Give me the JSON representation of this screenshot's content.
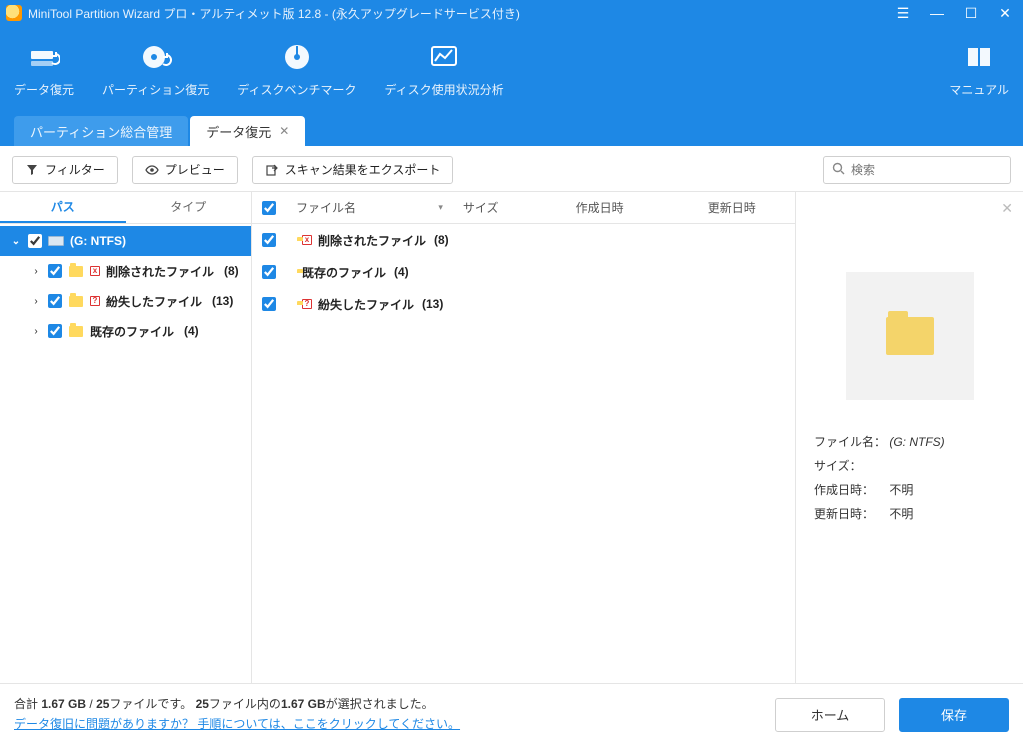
{
  "window": {
    "title": "MiniTool Partition Wizard プロ・アルティメット版 12.8 - (永久アップグレードサービス付き)"
  },
  "toolbar": {
    "items": [
      {
        "label": "データ復元"
      },
      {
        "label": "パーティション復元"
      },
      {
        "label": "ディスクベンチマーク"
      },
      {
        "label": "ディスク使用状況分析"
      }
    ],
    "manual": "マニュアル"
  },
  "tabs": {
    "inactive": "パーティション総合管理",
    "active": "データ復元"
  },
  "actions": {
    "filter": "フィルター",
    "preview": "プレビュー",
    "export": "スキャン結果をエクスポート",
    "search_placeholder": "検索"
  },
  "inner_tabs": {
    "path": "パス",
    "type": "タイプ"
  },
  "tree": {
    "root": {
      "label": "(G: NTFS)"
    },
    "children": [
      {
        "label": "削除されたファイル",
        "count": "(8)",
        "badge": "x"
      },
      {
        "label": "紛失したファイル",
        "count": "(13)",
        "badge": "?"
      },
      {
        "label": "既存のファイル",
        "count": "(4)",
        "badge": "folder"
      }
    ]
  },
  "list": {
    "headers": {
      "name": "ファイル名",
      "size": "サイズ",
      "ctime": "作成日時",
      "mtime": "更新日時"
    },
    "rows": [
      {
        "name": "削除されたファイル",
        "count": "(8)",
        "badge": "x"
      },
      {
        "name": "既存のファイル",
        "count": "(4)",
        "badge": "folder"
      },
      {
        "name": "紛失したファイル",
        "count": "(13)",
        "badge": "?"
      }
    ]
  },
  "preview": {
    "labels": {
      "filename": "ファイル名：",
      "size": "サイズ：",
      "ctime": "作成日時：",
      "mtime": "更新日時："
    },
    "values": {
      "filename": "(G: NTFS)",
      "size": "",
      "ctime": "不明",
      "mtime": "不明"
    }
  },
  "footer": {
    "line1_a": "合計 ",
    "line1_b": "1.67 GB",
    "line1_c": " / ",
    "line1_d": "25",
    "line1_e": "ファイルです。 ",
    "line1_f": "25",
    "line1_g": "ファイル内の",
    "line1_h": "1.67 GB",
    "line1_i": "が選択されました。",
    "help_link": "データ復旧に問題がありますか？ 手順については、ここをクリックしてください。",
    "home": "ホーム",
    "save": "保存"
  }
}
